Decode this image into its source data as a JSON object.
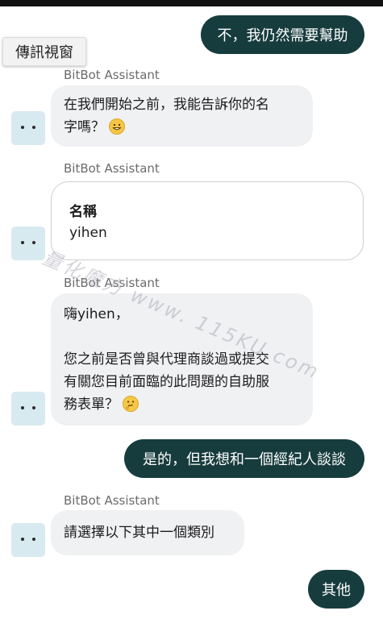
{
  "window_tab": {
    "label": "傳訊視窗"
  },
  "messages": {
    "user1": "不，我仍然需要幫助",
    "bot1_sender": "BitBot Assistant",
    "bot1_text_line1": "在我們開始之前，我能告訴你的名",
    "bot1_text_line2": "字嗎？",
    "bot1_emoji": "grinning-face-icon",
    "bot2_sender": "BitBot Assistant",
    "form_label": "名稱",
    "form_value": "yihen",
    "bot3_sender": "BitBot Assistant",
    "bot3_line1": "嗨yihen，",
    "bot3_line2": "您之前是否曾與代理商談過或提交",
    "bot3_line3": "有關您目前面臨的此問題的自助服",
    "bot3_line4": "務表單？",
    "bot3_emoji": "thinking-face-icon",
    "user2": "是的，但我想和一個經紀人談談",
    "bot4_sender": "BitBot Assistant",
    "bot4_text": "請選擇以下其中一個類別",
    "user3": "其他"
  },
  "watermark": "量化魔方 www. 115KU.com",
  "colors": {
    "user_bubble": "#173c3e",
    "bot_bubble": "#f0f1f3",
    "avatar": "#d7eaf0"
  }
}
